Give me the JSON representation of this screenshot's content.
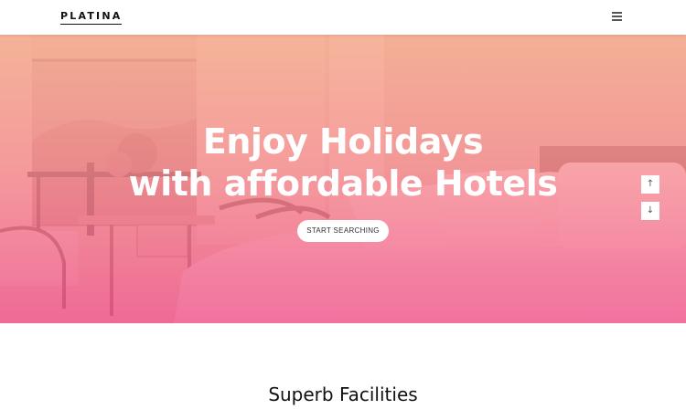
{
  "header": {
    "logo": "PLATINA",
    "menu_icon": "hamburger-menu-icon"
  },
  "hero": {
    "title_line1": "Enjoy Holidays",
    "title_line2": "with affordable Hotels",
    "cta_label": "START SEARCHING",
    "arrow_up": "↑",
    "arrow_down": "↓",
    "gradient_top": "#f6aa8c",
    "gradient_bottom": "#f0508c"
  },
  "facilities": {
    "title": "Superb Facilities"
  }
}
